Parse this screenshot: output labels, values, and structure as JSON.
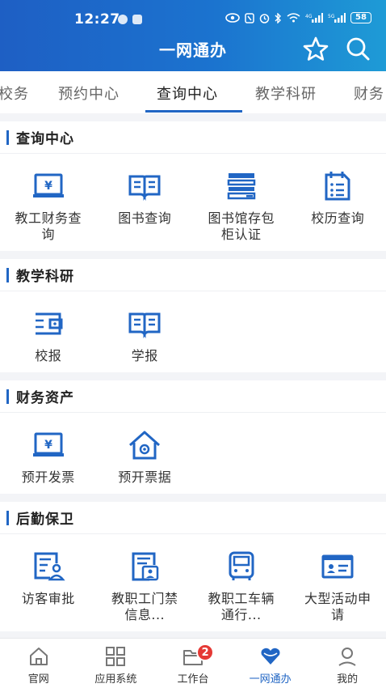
{
  "status": {
    "time": "12:27",
    "battery": "58"
  },
  "header": {
    "title": "一网通办"
  },
  "tabs": [
    {
      "label": "校务"
    },
    {
      "label": "预约中心"
    },
    {
      "label": "查询中心"
    },
    {
      "label": "教学科研"
    },
    {
      "label": "财务"
    }
  ],
  "active_tab": "查询中心",
  "sections": [
    {
      "title": "查询中心",
      "items": [
        {
          "label": "教工财务查询",
          "icon": "finance-query-icon"
        },
        {
          "label": "图书查询",
          "icon": "book-icon"
        },
        {
          "label": "图书馆存包柜认证",
          "icon": "locker-icon"
        },
        {
          "label": "校历查询",
          "icon": "calendar-icon"
        }
      ]
    },
    {
      "title": "教学科研",
      "items": [
        {
          "label": "校报",
          "icon": "wallet-icon"
        },
        {
          "label": "学报",
          "icon": "book-icon"
        }
      ]
    },
    {
      "title": "财务资产",
      "items": [
        {
          "label": "预开发票",
          "icon": "invoice-icon"
        },
        {
          "label": "预开票据",
          "icon": "house-icon"
        }
      ]
    },
    {
      "title": "后勤保卫",
      "items": [
        {
          "label": "访客审批",
          "icon": "visitor-approval-icon"
        },
        {
          "label": "教职工门禁信息...",
          "icon": "access-card-icon"
        },
        {
          "label": "教职工车辆通行...",
          "icon": "bus-icon"
        },
        {
          "label": "大型活动申请",
          "icon": "id-card-icon"
        }
      ]
    }
  ],
  "bottom_nav": [
    {
      "label": "官网",
      "icon": "home-icon"
    },
    {
      "label": "应用系统",
      "icon": "apps-grid-icon"
    },
    {
      "label": "工作台",
      "icon": "folder-icon",
      "badge": "2"
    },
    {
      "label": "一网通办",
      "icon": "heart-icon",
      "active": true
    },
    {
      "label": "我的",
      "icon": "user-icon"
    }
  ],
  "colors": {
    "primary": "#2166c4",
    "header_start": "#1e5fc4",
    "header_end": "#1e9bd6",
    "badge": "#e53935"
  }
}
